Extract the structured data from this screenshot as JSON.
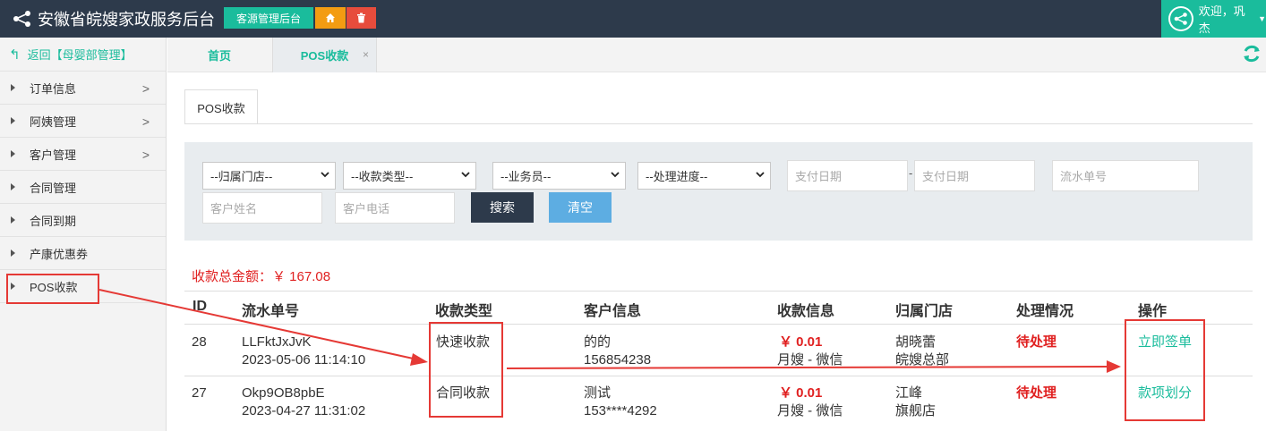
{
  "header": {
    "title": "安徽省皖嫂家政服务后台",
    "btn_source": "客源管理后台",
    "btn_home_icon": "home-icon",
    "btn_delete_icon": "trash-icon",
    "welcome": "欢迎，巩杰"
  },
  "sidebar": {
    "back": "返回【母婴部管理】",
    "items": [
      {
        "label": "订单信息",
        "has_chevron": true
      },
      {
        "label": "阿姨管理",
        "has_chevron": true
      },
      {
        "label": "客户管理",
        "has_chevron": true
      },
      {
        "label": "合同管理",
        "has_chevron": false
      },
      {
        "label": "合同到期",
        "has_chevron": false
      },
      {
        "label": "产康优惠券",
        "has_chevron": false
      },
      {
        "label": "POS收款",
        "has_chevron": false
      }
    ]
  },
  "tabs": {
    "home": "首页",
    "pos": "POS收款",
    "close": "×"
  },
  "content": {
    "inner_tab": "POS收款",
    "filters": {
      "store": "--归属门店--",
      "type": "--收款类型--",
      "sales": "--业务员--",
      "progress": "--处理进度--",
      "date_from_placeholder": "支付日期",
      "date_sep": "-",
      "date_to_placeholder": "支付日期",
      "serial_placeholder": "流水单号",
      "name_placeholder": "客户姓名",
      "phone_placeholder": "客户电话",
      "search": "搜索",
      "clear": "清空"
    },
    "total": "收款总金额：￥ 167.08",
    "table": {
      "headers": [
        "ID",
        "流水单号",
        "收款类型",
        "客户信息",
        "收款信息",
        "归属门店",
        "处理情况",
        "操作"
      ],
      "rows": [
        {
          "id": "28",
          "serial": "LLFktJxJvK",
          "time": "2023-05-06 11:14:10",
          "type": "快速收款",
          "cust_name": "的的",
          "cust_phone": "156854238",
          "amount": "￥ 0.01",
          "pay_info": "月嫂 - 微信",
          "store1": "胡晓蕾",
          "store2": "皖嫂总部",
          "status": "待处理",
          "action": "立即签单"
        },
        {
          "id": "27",
          "serial": "Okp9OB8pbE",
          "time": "2023-04-27 11:31:02",
          "type": "合同收款",
          "cust_name": "测试",
          "cust_phone": "153****4292",
          "amount": "￥ 0.01",
          "pay_info": "月嫂 - 微信",
          "store1": "江峰",
          "store2": "旗舰店",
          "status": "待处理",
          "action": "款项划分"
        }
      ]
    }
  },
  "colors": {
    "header_bg": "#2d3a4b",
    "accent": "#1abc9c",
    "danger": "#e02020",
    "annotation": "#e53935"
  }
}
